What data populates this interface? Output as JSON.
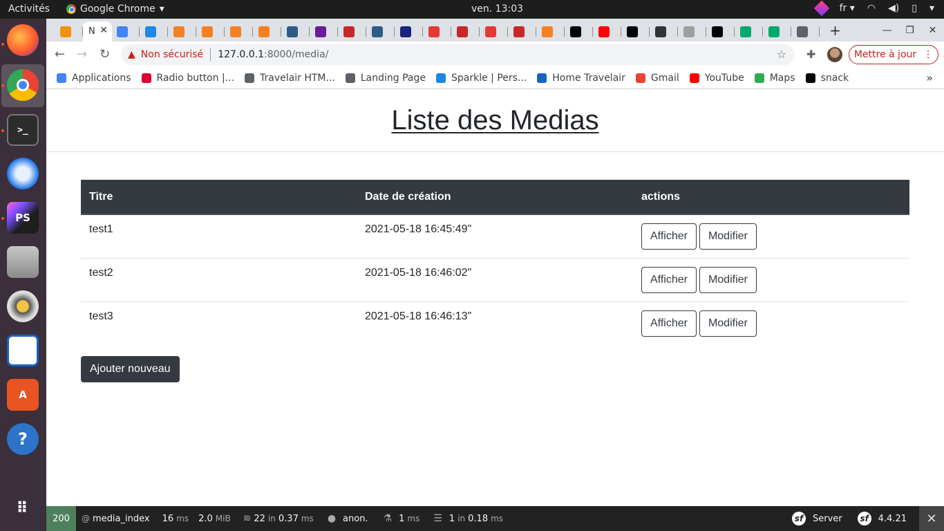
{
  "os": {
    "activities": "Activités",
    "app_name": "Google Chrome",
    "clock": "ven. 13:03",
    "language": "fr"
  },
  "dock": {
    "items": [
      "firefox-icon",
      "chrome-icon",
      "terminal-icon",
      "thunderbird-icon",
      "phpstorm-icon",
      "files-icon",
      "rhythmbox-icon",
      "writer-icon",
      "software-center-icon",
      "help-icon",
      "app-grid-icon"
    ],
    "phpstorm_label": "PS"
  },
  "browser": {
    "tabs": [
      {
        "icon": "phpmyadmin-icon",
        "color": "#f29111"
      },
      {
        "icon": "active-tab-icon",
        "color": "#333333",
        "label": "N",
        "active": true
      },
      {
        "icon": "google-icon",
        "color": "#4285f4"
      },
      {
        "icon": "sensiolabs-icon",
        "color": "#1e88e5"
      },
      {
        "icon": "stackoverflow-icon",
        "color": "#f48024"
      },
      {
        "icon": "stackoverflow-icon",
        "color": "#f48024"
      },
      {
        "icon": "stackoverflow-icon",
        "color": "#f48024"
      },
      {
        "icon": "stackoverflow-icon",
        "color": "#f48024"
      },
      {
        "icon": "t-icon",
        "color": "#2e5a88"
      },
      {
        "icon": "mail-icon",
        "color": "#6a1b9a"
      },
      {
        "icon": "news-icon",
        "color": "#c62828"
      },
      {
        "icon": "t-icon",
        "color": "#2e5a88"
      },
      {
        "icon": "site-icon",
        "color": "#1a237e"
      },
      {
        "icon": "pdf-icon",
        "color": "#e53935"
      },
      {
        "icon": "news-icon",
        "color": "#c62828"
      },
      {
        "icon": "pdf-icon",
        "color": "#e53935"
      },
      {
        "icon": "news-icon",
        "color": "#c62828"
      },
      {
        "icon": "stackoverflow-icon",
        "color": "#f48024"
      },
      {
        "icon": "symfony-icon",
        "color": "#000000"
      },
      {
        "icon": "youtube-icon",
        "color": "#ff0000"
      },
      {
        "icon": "symfony-icon",
        "color": "#000000"
      },
      {
        "icon": "five-icon",
        "color": "#333333"
      },
      {
        "icon": "facebook-icon",
        "color": "#9e9e9e"
      },
      {
        "icon": "symfony-icon",
        "color": "#000000"
      },
      {
        "icon": "w3schools-icon",
        "color": "#04aa6d"
      },
      {
        "icon": "w3schools-icon",
        "color": "#04aa6d"
      },
      {
        "icon": "globe-icon",
        "color": "#5f6368"
      }
    ],
    "new_tab": "+",
    "url_warning": "Non sécurisé",
    "url_host": "127.0.0.1",
    "url_path": ":8000/media/",
    "update_button": "Mettre à jour",
    "bookmarks": [
      {
        "label": "Applications",
        "icon": "apps-icon",
        "color": "#4285f4"
      },
      {
        "label": "Radio button |...",
        "icon": "angular-icon",
        "color": "#dd0031"
      },
      {
        "label": "Travelair HTM...",
        "icon": "globe-icon",
        "color": "#5f6368"
      },
      {
        "label": "Landing Page",
        "icon": "globe-icon",
        "color": "#5f6368"
      },
      {
        "label": "Sparkle | Pers...",
        "icon": "sparkle-icon",
        "color": "#1e88e5"
      },
      {
        "label": "Home Travelair",
        "icon": "travelair-icon",
        "color": "#1565c0"
      },
      {
        "label": "Gmail",
        "icon": "gmail-icon",
        "color": "#ea4335"
      },
      {
        "label": "YouTube",
        "icon": "youtube-icon",
        "color": "#ff0000"
      },
      {
        "label": "Maps",
        "icon": "maps-icon",
        "color": "#34a853"
      },
      {
        "label": "snack",
        "icon": "snack-icon",
        "color": "#000000"
      }
    ],
    "bookmarks_more": "»"
  },
  "page": {
    "title": "Liste des Medias",
    "table": {
      "headers": [
        "Titre",
        "Date de création",
        "actions"
      ],
      "rows": [
        {
          "title": "test1",
          "date": "2021-05-18 16:45:49\"",
          "show": "Afficher",
          "edit": "Modifier"
        },
        {
          "title": "test2",
          "date": "2021-05-18 16:46:02\"",
          "show": "Afficher",
          "edit": "Modifier"
        },
        {
          "title": "test3",
          "date": "2021-05-18 16:46:13\"",
          "show": "Afficher",
          "edit": "Modifier"
        }
      ]
    },
    "add_button": "Ajouter nouveau"
  },
  "debug_toolbar": {
    "status": "200",
    "route_prefix": "@",
    "route": "media_index",
    "time": "16",
    "time_unit": "ms",
    "memory": "2.0",
    "memory_unit": "MiB",
    "twig_count": "22",
    "twig_in": "in",
    "twig_time": "0.37",
    "twig_unit": "ms",
    "user": "anon.",
    "cache_count": "1",
    "cache_unit": "ms",
    "db_count": "1",
    "db_in": "in",
    "db_time": "0.18",
    "db_unit": "ms",
    "server": "Server",
    "version": "4.4.21",
    "colors": {
      "status_ok": "#4f805d"
    }
  }
}
